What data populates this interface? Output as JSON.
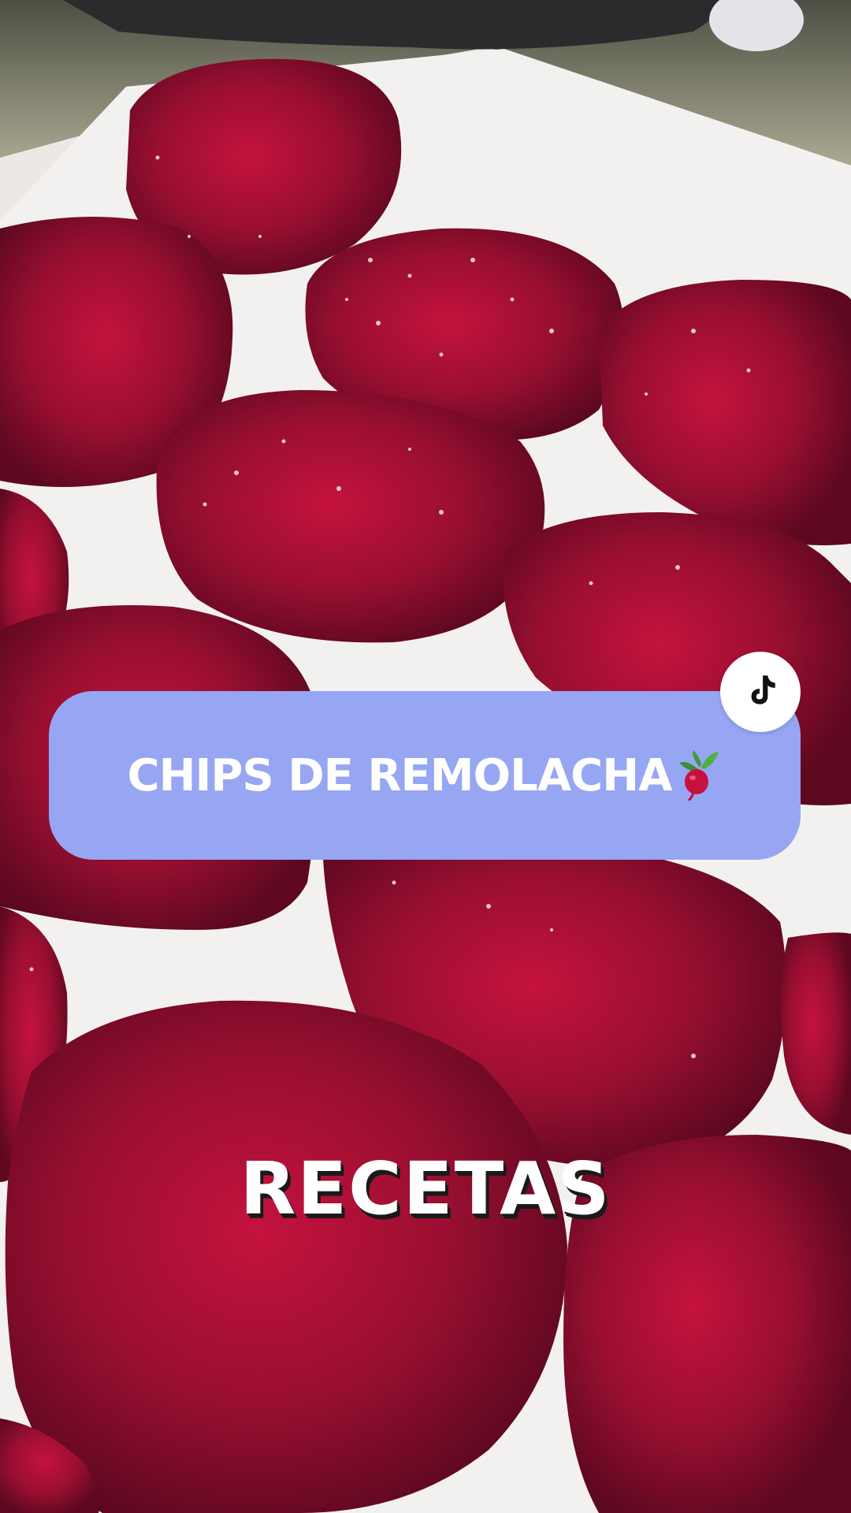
{
  "overlay": {
    "title": "CHIPS DE REMOLACHA",
    "caption": "RECETAS",
    "pill_color": "#96a6f2"
  },
  "icons": {
    "brand": "tiktok-icon",
    "emoji": "radish-icon"
  },
  "colors": {
    "beet": "#8e0c2a",
    "paper": "#f1efee"
  }
}
